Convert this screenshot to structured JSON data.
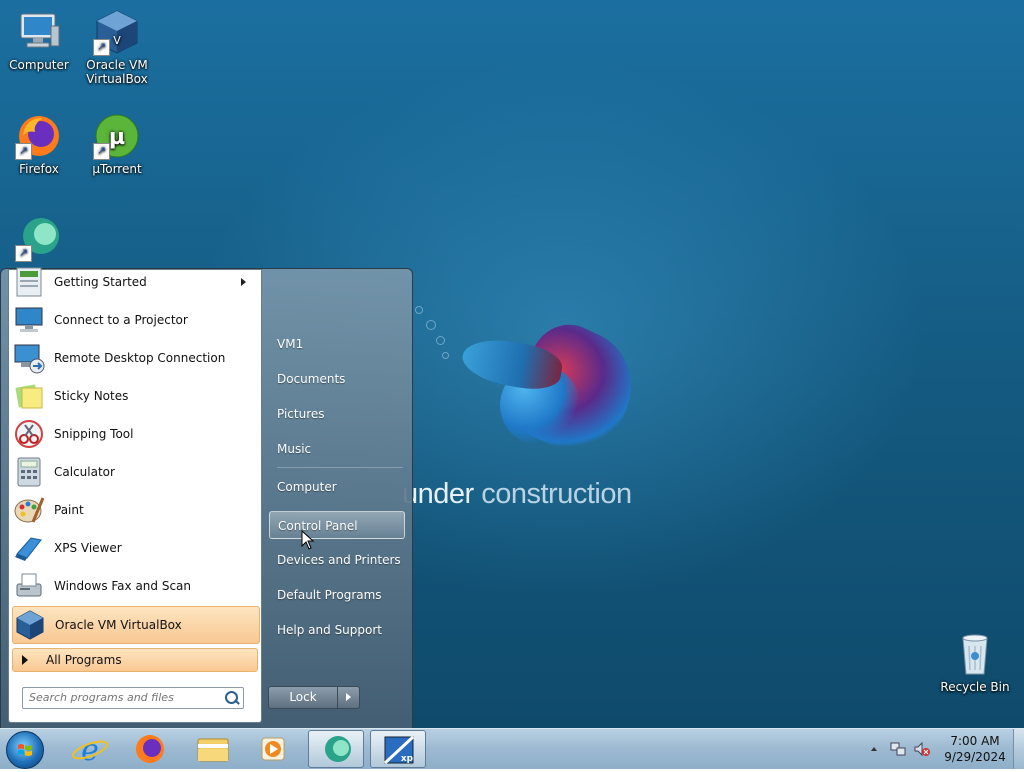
{
  "desktop": {
    "wallpaper_text_bold": "under",
    "wallpaper_text_light": "construction",
    "icons": {
      "computer": "Computer",
      "virtualbox_line1": "Oracle VM",
      "virtualbox_line2": "VirtualBox",
      "firefox": "Firefox",
      "utorrent": "µTorrent",
      "recycle_bin": "Recycle Bin"
    }
  },
  "start_menu": {
    "programs": [
      {
        "label": "Getting Started",
        "icon": "getting-started-icon",
        "has_submenu": true
      },
      {
        "label": "Connect to a Projector",
        "icon": "projector-icon"
      },
      {
        "label": "Remote Desktop Connection",
        "icon": "remote-desktop-icon"
      },
      {
        "label": "Sticky Notes",
        "icon": "sticky-notes-icon"
      },
      {
        "label": "Snipping Tool",
        "icon": "scissors-icon"
      },
      {
        "label": "Calculator",
        "icon": "calculator-icon"
      },
      {
        "label": "Paint",
        "icon": "paint-palette-icon"
      },
      {
        "label": "XPS Viewer",
        "icon": "xps-viewer-icon"
      },
      {
        "label": "Windows Fax and Scan",
        "icon": "fax-icon"
      },
      {
        "label": "Oracle VM VirtualBox",
        "icon": "virtualbox-icon",
        "highlighted": true
      }
    ],
    "all_programs": "All Programs",
    "search_placeholder": "Search programs and files",
    "right_links": {
      "user": "VM1",
      "documents": "Documents",
      "pictures": "Pictures",
      "music": "Music",
      "computer": "Computer",
      "control_panel": "Control Panel",
      "devices_printers": "Devices and Printers",
      "default_programs": "Default Programs",
      "help_support": "Help and Support"
    },
    "highlighted_link": "Control Panel",
    "lock_button": "Lock"
  },
  "taskbar": {
    "pinned": [
      "internet-explorer-icon",
      "firefox-icon",
      "file-explorer-icon",
      "media-player-icon",
      "app-bubble-icon",
      "xp-mode-icon"
    ],
    "clock_time": "7:00 AM",
    "clock_date": "9/29/2024"
  },
  "colors": {
    "menu_highlight": "#f9c892",
    "desktop_blue": "#14597f",
    "taskbar": "#9cb9d1"
  }
}
